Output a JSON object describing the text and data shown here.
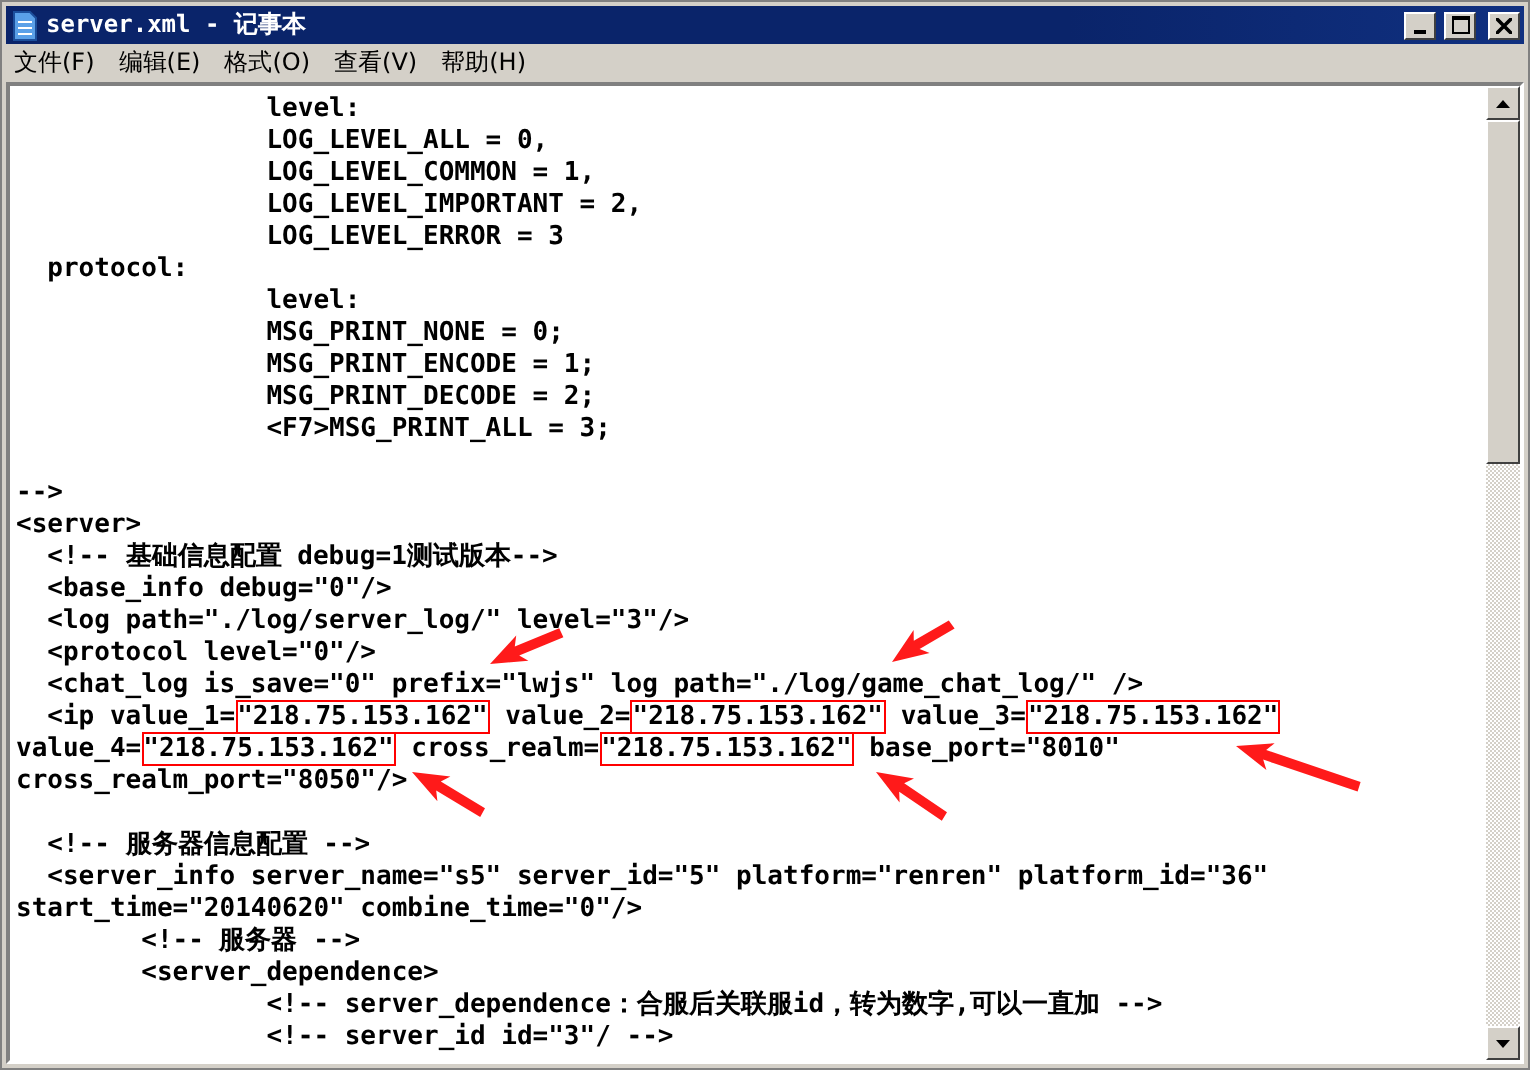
{
  "window": {
    "title": "server.xml - 记事本"
  },
  "menu": [
    "文件(F)",
    "编辑(E)",
    "格式(O)",
    "查看(V)",
    "帮助(H)"
  ],
  "lines": [
    [
      {
        "kind": "plain",
        "text": "                level:"
      }
    ],
    [
      {
        "kind": "plain",
        "text": "                LOG_LEVEL_ALL = 0,"
      }
    ],
    [
      {
        "kind": "plain",
        "text": "                LOG_LEVEL_COMMON = 1,"
      }
    ],
    [
      {
        "kind": "plain",
        "text": "                LOG_LEVEL_IMPORTANT = 2,"
      }
    ],
    [
      {
        "kind": "plain",
        "text": "                LOG_LEVEL_ERROR = 3"
      }
    ],
    [
      {
        "kind": "plain",
        "text": "  protocol:"
      }
    ],
    [
      {
        "kind": "plain",
        "text": "                level:"
      }
    ],
    [
      {
        "kind": "plain",
        "text": "                MSG_PRINT_NONE = 0;"
      }
    ],
    [
      {
        "kind": "plain",
        "text": "                MSG_PRINT_ENCODE = 1;"
      }
    ],
    [
      {
        "kind": "plain",
        "text": "                MSG_PRINT_DECODE = 2;"
      }
    ],
    [
      {
        "kind": "plain",
        "text": "                <F7>MSG_PRINT_ALL = 3;"
      }
    ],
    [
      {
        "kind": "blank"
      }
    ],
    [
      {
        "kind": "plain",
        "text": "-->"
      }
    ],
    [
      {
        "kind": "plain",
        "text": "<server>"
      }
    ],
    [
      {
        "kind": "plain",
        "text": "  <!-- 基础信息配置 debug=1测试版本-->"
      }
    ],
    [
      {
        "kind": "plain",
        "text": "  <base_info debug=\"0\"/>"
      }
    ],
    [
      {
        "kind": "plain",
        "text": "  <log path=\"./log/server_log/\" level=\"3\"/>"
      }
    ],
    [
      {
        "kind": "plain",
        "text": "  <protocol level=\"0\"/>"
      }
    ],
    [
      {
        "kind": "plain",
        "text": "  <chat_log is_save=\"0\" prefix=\"lwjs\" log path=\"./log/game_chat_log/\" />"
      }
    ],
    [
      {
        "kind": "plain",
        "text": "  <ip value_1="
      },
      {
        "kind": "boxed",
        "text": "\"218.75.153.162\""
      },
      {
        "kind": "plain",
        "text": " value_2="
      },
      {
        "kind": "boxed",
        "text": "\"218.75.153.162\""
      },
      {
        "kind": "plain",
        "text": " value_3="
      },
      {
        "kind": "boxed",
        "text": "\"218.75.153.162\""
      }
    ],
    [
      {
        "kind": "plain",
        "text": "value_4="
      },
      {
        "kind": "boxed",
        "text": "\"218.75.153.162\""
      },
      {
        "kind": "plain",
        "text": " cross_realm="
      },
      {
        "kind": "boxed",
        "text": "\"218.75.153.162\""
      },
      {
        "kind": "plain",
        "text": " base_port=\"8010\""
      }
    ],
    [
      {
        "kind": "plain",
        "text": "cross_realm_port=\"8050\"/>"
      }
    ],
    [
      {
        "kind": "blank"
      }
    ],
    [
      {
        "kind": "plain",
        "text": "  <!-- 服务器信息配置 -->"
      }
    ],
    [
      {
        "kind": "plain",
        "text": "  <server_info server_name=\"s5\" server_id=\"5\" platform=\"renren\" platform_id=\"36\""
      }
    ],
    [
      {
        "kind": "plain",
        "text": "start_time=\"20140620\" combine_time=\"0\"/>"
      }
    ],
    [
      {
        "kind": "plain",
        "text": "        <!-- 服务器 -->"
      }
    ],
    [
      {
        "kind": "plain",
        "text": "        <server_dependence>"
      }
    ],
    [
      {
        "kind": "plain",
        "text": "                <!-- server_dependence：合服后关联服id，转为数字,可以一直加 -->"
      }
    ],
    [
      {
        "kind": "plain",
        "text": "                <!-- server_id id=\"3\"/ -->"
      }
    ]
  ]
}
